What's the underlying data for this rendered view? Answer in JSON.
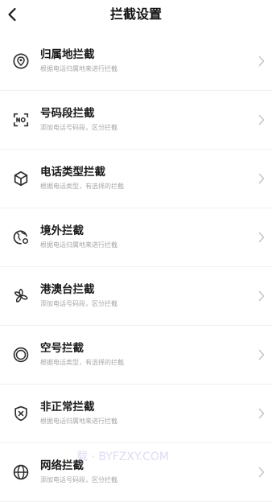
{
  "header": {
    "title": "拦截设置"
  },
  "items": [
    {
      "title": "归属地拦截",
      "subtitle": "根据电话归属地来进行拦截",
      "icon": "location-pin-icon"
    },
    {
      "title": "号码段拦截",
      "subtitle": "添加电话号码段，区分拦截",
      "icon": "number-scan-icon"
    },
    {
      "title": "电话类型拦截",
      "subtitle": "根据电话类型，有选择的拦截",
      "icon": "cube-icon"
    },
    {
      "title": "境外拦截",
      "subtitle": "根据电话归属地来进行拦截",
      "icon": "globe-icon"
    },
    {
      "title": "港澳台拦截",
      "subtitle": "添加电话号码段，区分拦截",
      "icon": "flower-icon"
    },
    {
      "title": "空号拦截",
      "subtitle": "根据电话类型，有选择的拦截",
      "icon": "ring-icon"
    },
    {
      "title": "非正常拦截",
      "subtitle": "根据电话归属地来进行拦截",
      "icon": "shield-x-icon"
    },
    {
      "title": "网络拦截",
      "subtitle": "添加电话号码段，区分拦截",
      "icon": "globe-grid-icon"
    }
  ],
  "watermark": "载 · BYFZXY.COM",
  "colors": {
    "title": "#1a1a1a",
    "subtitle": "#a6a6a6",
    "chevron": "#c4c4c4",
    "icon": "#2b2b2b",
    "divider": "#f1f1f1"
  }
}
